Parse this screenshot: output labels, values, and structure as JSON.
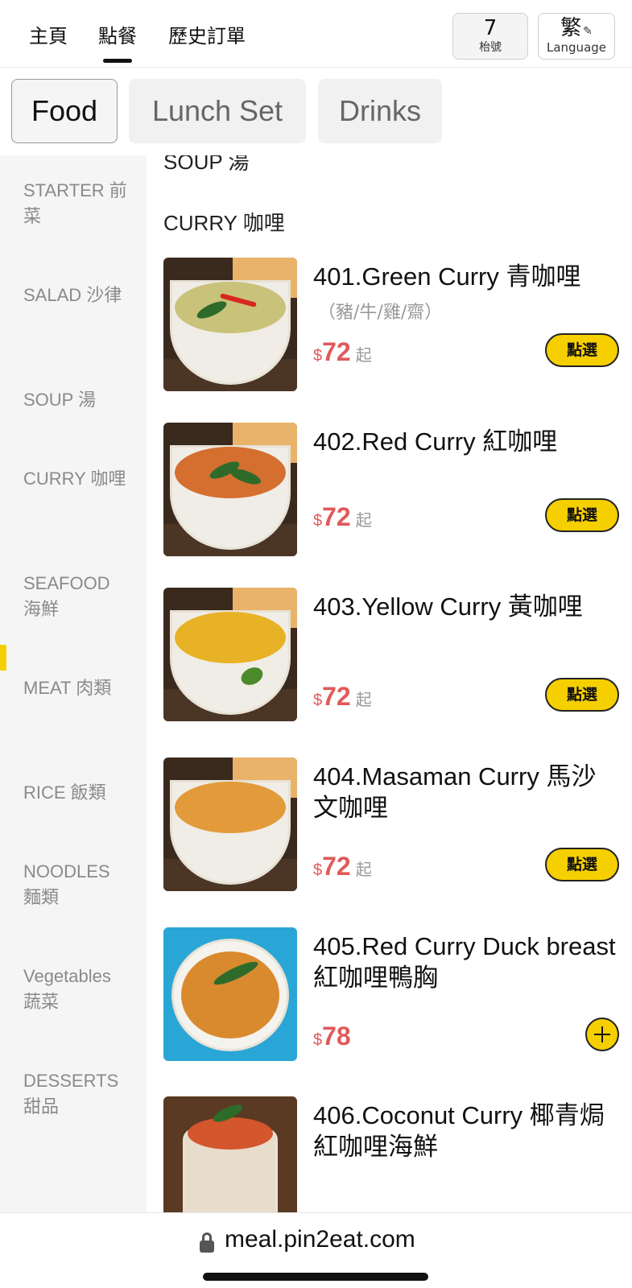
{
  "nav": {
    "links": [
      "主頁",
      "點餐",
      "歷史訂單"
    ],
    "active": "點餐",
    "table_number": "7",
    "table_label": "枱號",
    "lang_char": "繁",
    "lang_label": "Language"
  },
  "tabs": [
    "Food",
    "Lunch Set",
    "Drinks"
  ],
  "active_tab": "Food",
  "sidebar": {
    "items": [
      "STARTER 前菜",
      "SALAD 沙律",
      "SOUP 湯",
      "CURRY 咖哩",
      "SEAFOOD 海鮮",
      "MEAT 肉類",
      "RICE 飯類",
      "NOODLES 麵類",
      "Vegetables 蔬菜",
      "DESSERTS 甜品"
    ],
    "active": "CURRY 咖哩"
  },
  "main": {
    "prev_section": "SOUP 湯",
    "section": "CURRY 咖哩",
    "dishes": [
      {
        "name": "401.Green Curry 青咖哩",
        "sub": "（豬/牛/雞/齋）",
        "currency": "$",
        "price": "72",
        "suffix": "起",
        "button": "點選"
      },
      {
        "name": "402.Red Curry 紅咖哩",
        "sub": "",
        "currency": "$",
        "price": "72",
        "suffix": "起",
        "button": "點選"
      },
      {
        "name": "403.Yellow Curry 黃咖哩",
        "sub": "",
        "currency": "$",
        "price": "72",
        "suffix": "起",
        "button": "點選"
      },
      {
        "name": "404.Masaman Curry 馬沙文咖哩",
        "sub": "",
        "currency": "$",
        "price": "72",
        "suffix": "起",
        "button": "點選"
      },
      {
        "name": "405.Red Curry Duck breast 紅咖哩鴨胸",
        "sub": "",
        "currency": "$",
        "price": "78",
        "suffix": "",
        "button": ""
      },
      {
        "name": "406.Coconut Curry 椰青焗紅咖哩海鮮",
        "sub": "",
        "currency": "",
        "price": "",
        "suffix": "",
        "button": ""
      }
    ]
  },
  "url": "meal.pin2eat.com",
  "colors": {
    "accent": "#f5cf00",
    "price": "#e05a5a",
    "sidebar_bg": "#f5f5f5"
  },
  "icons": {
    "pencil": "pencil-icon",
    "lock": "lock-icon",
    "plus": "plus-icon"
  }
}
